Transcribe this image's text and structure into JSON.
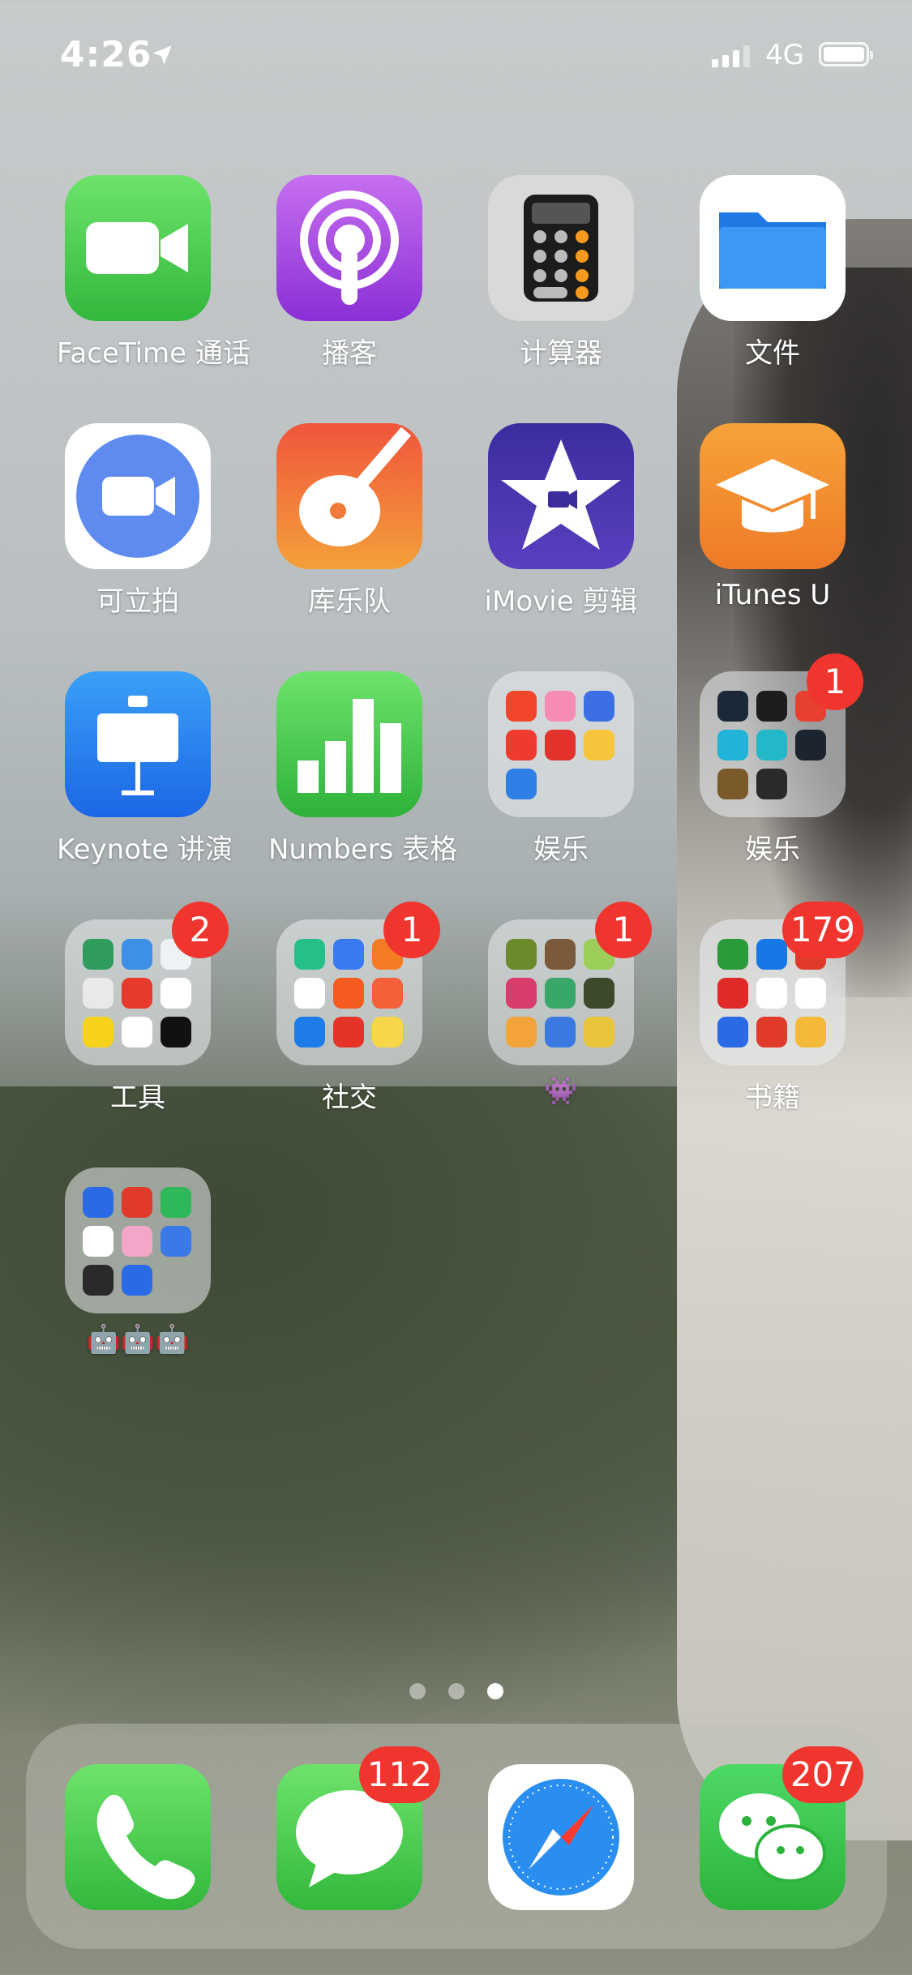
{
  "status_bar": {
    "time": "4:26",
    "network": "4G"
  },
  "apps": [
    {
      "name": "FaceTime 通话"
    },
    {
      "name": "播客"
    },
    {
      "name": "计算器"
    },
    {
      "name": "文件"
    },
    {
      "name": "可立拍"
    },
    {
      "name": "库乐队"
    },
    {
      "name": "iMovie 剪辑"
    },
    {
      "name": "iTunes U"
    },
    {
      "name": "Keynote 讲演"
    },
    {
      "name": "Numbers 表格"
    }
  ],
  "folders": [
    {
      "name": "娱乐",
      "badge": ""
    },
    {
      "name": "娱乐",
      "badge": "1"
    },
    {
      "name": "工具",
      "badge": "2"
    },
    {
      "name": "社交",
      "badge": "1"
    },
    {
      "name": "👾",
      "badge": "1"
    },
    {
      "name": "书籍",
      "badge": "179"
    },
    {
      "name": "🤖🤖🤖",
      "badge": ""
    }
  ],
  "page_dots": {
    "count": 3,
    "active": 3
  },
  "dock": [
    {
      "name": "Phone",
      "badge": ""
    },
    {
      "name": "Messages",
      "badge": "112"
    },
    {
      "name": "Safari",
      "badge": ""
    },
    {
      "name": "WeChat",
      "badge": "207"
    }
  ],
  "colors": {
    "badge": "#f0352f",
    "facetime": "#4cd964",
    "podcasts": "#a347e0",
    "files": "#2f8cf0"
  }
}
